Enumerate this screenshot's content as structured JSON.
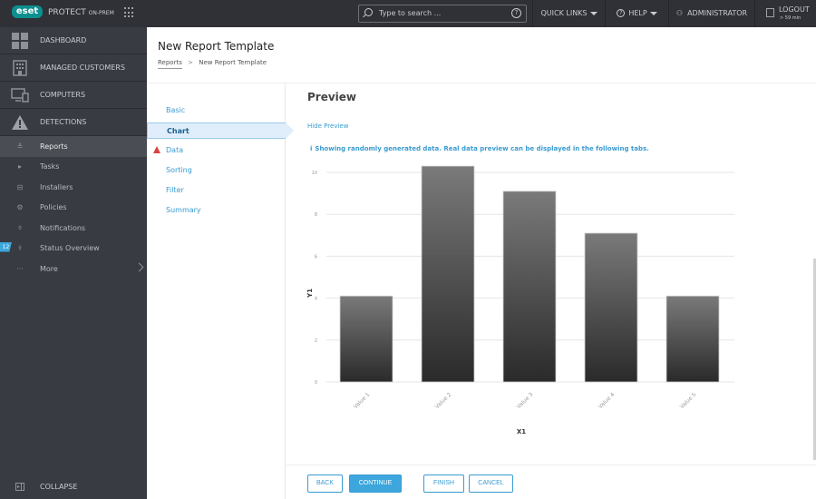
{
  "topbar": {
    "logo": "eset",
    "product_name": "PROTECT",
    "product_suffix": "ON-PREM",
    "search_placeholder": "Type to search ...",
    "quick_links": "QUICK LINKS",
    "help": "HELP",
    "user": "ADMINISTRATOR",
    "logout": "LOGOUT",
    "logout_time": "> 59 min"
  },
  "sidebar": {
    "major": [
      {
        "label": "DASHBOARD",
        "icon": "dashboard-icon"
      },
      {
        "label": "MANAGED CUSTOMERS",
        "icon": "building-icon"
      },
      {
        "label": "COMPUTERS",
        "icon": "computers-icon"
      },
      {
        "label": "DETECTIONS",
        "icon": "warning-icon"
      }
    ],
    "minor": [
      {
        "label": "Reports",
        "icon": "reports-icon",
        "glyph": "≚"
      },
      {
        "label": "Tasks",
        "icon": "tasks-icon",
        "glyph": "▸"
      },
      {
        "label": "Installers",
        "icon": "installers-icon",
        "glyph": "⊟"
      },
      {
        "label": "Policies",
        "icon": "policies-icon",
        "glyph": "⚙"
      },
      {
        "label": "Notifications",
        "icon": "notifications-icon",
        "glyph": "⌽"
      },
      {
        "label": "Status Overview",
        "icon": "status-icon",
        "glyph": "⚕"
      },
      {
        "label": "More",
        "icon": "more-icon",
        "glyph": "···"
      }
    ],
    "status_badge": "12",
    "collapse": "COLLAPSE"
  },
  "header": {
    "title": "New Report Template",
    "breadcrumb": [
      "Reports",
      "New Report Template"
    ]
  },
  "steps": [
    {
      "label": "Basic"
    },
    {
      "label": "Chart",
      "active": true
    },
    {
      "label": "Data",
      "warning": true
    },
    {
      "label": "Sorting"
    },
    {
      "label": "Filter"
    },
    {
      "label": "Summary"
    }
  ],
  "content": {
    "preview_title": "Preview",
    "hide_preview": "Hide Preview",
    "info_icon": "i",
    "info_message": "Showing randomly generated data. Real data preview can be displayed in the following tabs."
  },
  "footer": {
    "back": "BACK",
    "continue": "CONTINUE",
    "finish": "FINISH",
    "cancel": "CANCEL"
  },
  "chart_data": {
    "type": "bar",
    "categories": [
      "Value 1",
      "Value 2",
      "Value 3",
      "Value 4",
      "Value 5"
    ],
    "values": [
      4.1,
      10.3,
      9.1,
      7.1,
      4.1
    ],
    "title": "",
    "xlabel": "X1",
    "ylabel": "Y1",
    "ylim": [
      0,
      10
    ],
    "yticks": [
      0,
      2,
      4,
      6,
      8,
      10
    ],
    "grid": true,
    "legend": "none"
  }
}
